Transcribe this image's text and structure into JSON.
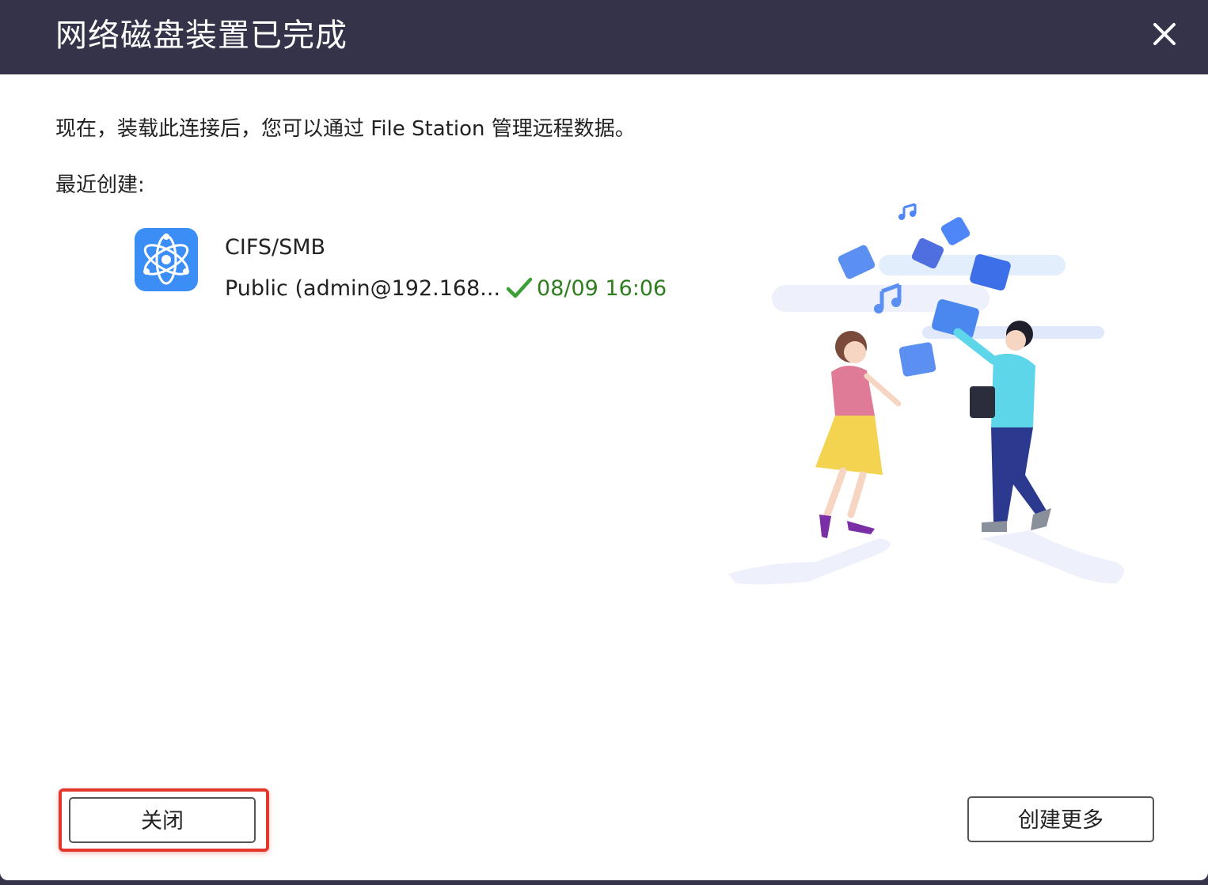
{
  "dialog": {
    "title": "网络磁盘装置已完成",
    "description": "现在，装载此连接后，您可以通过 File Station 管理远程数据。",
    "recent_label": "最近创建:"
  },
  "recent_item": {
    "type": "CIFS/SMB",
    "name": "Public (admin@192.168...",
    "time": "08/09 16:06",
    "icon": "cifs-smb-atom-icon",
    "status_icon": "checkmark-icon"
  },
  "buttons": {
    "close_label": "关闭",
    "create_more_label": "创建更多"
  },
  "colors": {
    "titlebar": "#34334a",
    "accent": "#3b8ef5",
    "success": "#2e7d1f",
    "highlight": "#e3372c"
  }
}
